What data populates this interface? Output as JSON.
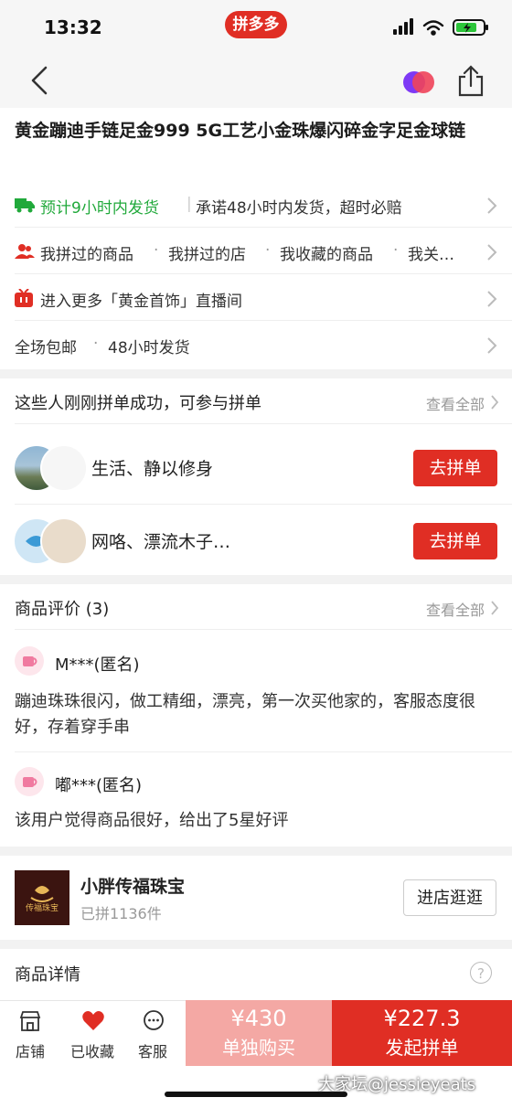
{
  "status": {
    "time": "13:32"
  },
  "app": {
    "badge": "拼多多"
  },
  "colors": {
    "accent": "#e02e24",
    "accent_light": "#f4a8a4",
    "ship_green": "#21a93b"
  },
  "product": {
    "title": "黄金蹦迪手链足金999 5G工艺小金珠爆闪碎金字足金球链"
  },
  "info_rows": {
    "shipping_highlight": "预计9小时内发货",
    "shipping_promise": "承诺48小时内发货，超时必赔",
    "history": [
      "我拼过的商品",
      "我拼过的店",
      "我收藏的商品",
      "我关…"
    ],
    "live": "进入更多「黄金首饰」直播间",
    "service": [
      "全场包邮",
      "48小时发货"
    ]
  },
  "group_buy": {
    "header": "这些人刚刚拼单成功，可参与拼单",
    "see_all": "查看全部",
    "rows": [
      {
        "name": "生活、静以修身",
        "button": "去拼单"
      },
      {
        "name": "网咯、漂流木子…",
        "button": "去拼单"
      }
    ]
  },
  "reviews": {
    "header": "商品评价 (3)",
    "see_all": "查看全部",
    "items": [
      {
        "user": "M***(匿名)",
        "text": "蹦迪珠珠很闪，做工精细，漂亮，第一次买他家的，客服态度很好，存着穿手串"
      },
      {
        "user": "嘟***(匿名)",
        "text": "该用户觉得商品很好，给出了5星好评"
      }
    ]
  },
  "shop": {
    "name": "小胖传福珠宝",
    "sold": "已拼1136件",
    "enter": "进店逛逛",
    "logo_text": "传福珠宝"
  },
  "details": {
    "title": "商品详情",
    "help": "?"
  },
  "bottom_bar": {
    "tabs": [
      {
        "label": "店铺"
      },
      {
        "label": "已收藏"
      },
      {
        "label": "客服"
      }
    ],
    "buy_alone": {
      "price": "¥430",
      "label": "单独购买"
    },
    "buy_group": {
      "price": "¥227.3",
      "label": "发起拼单"
    }
  },
  "watermark": "大家坛@jessieyeats"
}
